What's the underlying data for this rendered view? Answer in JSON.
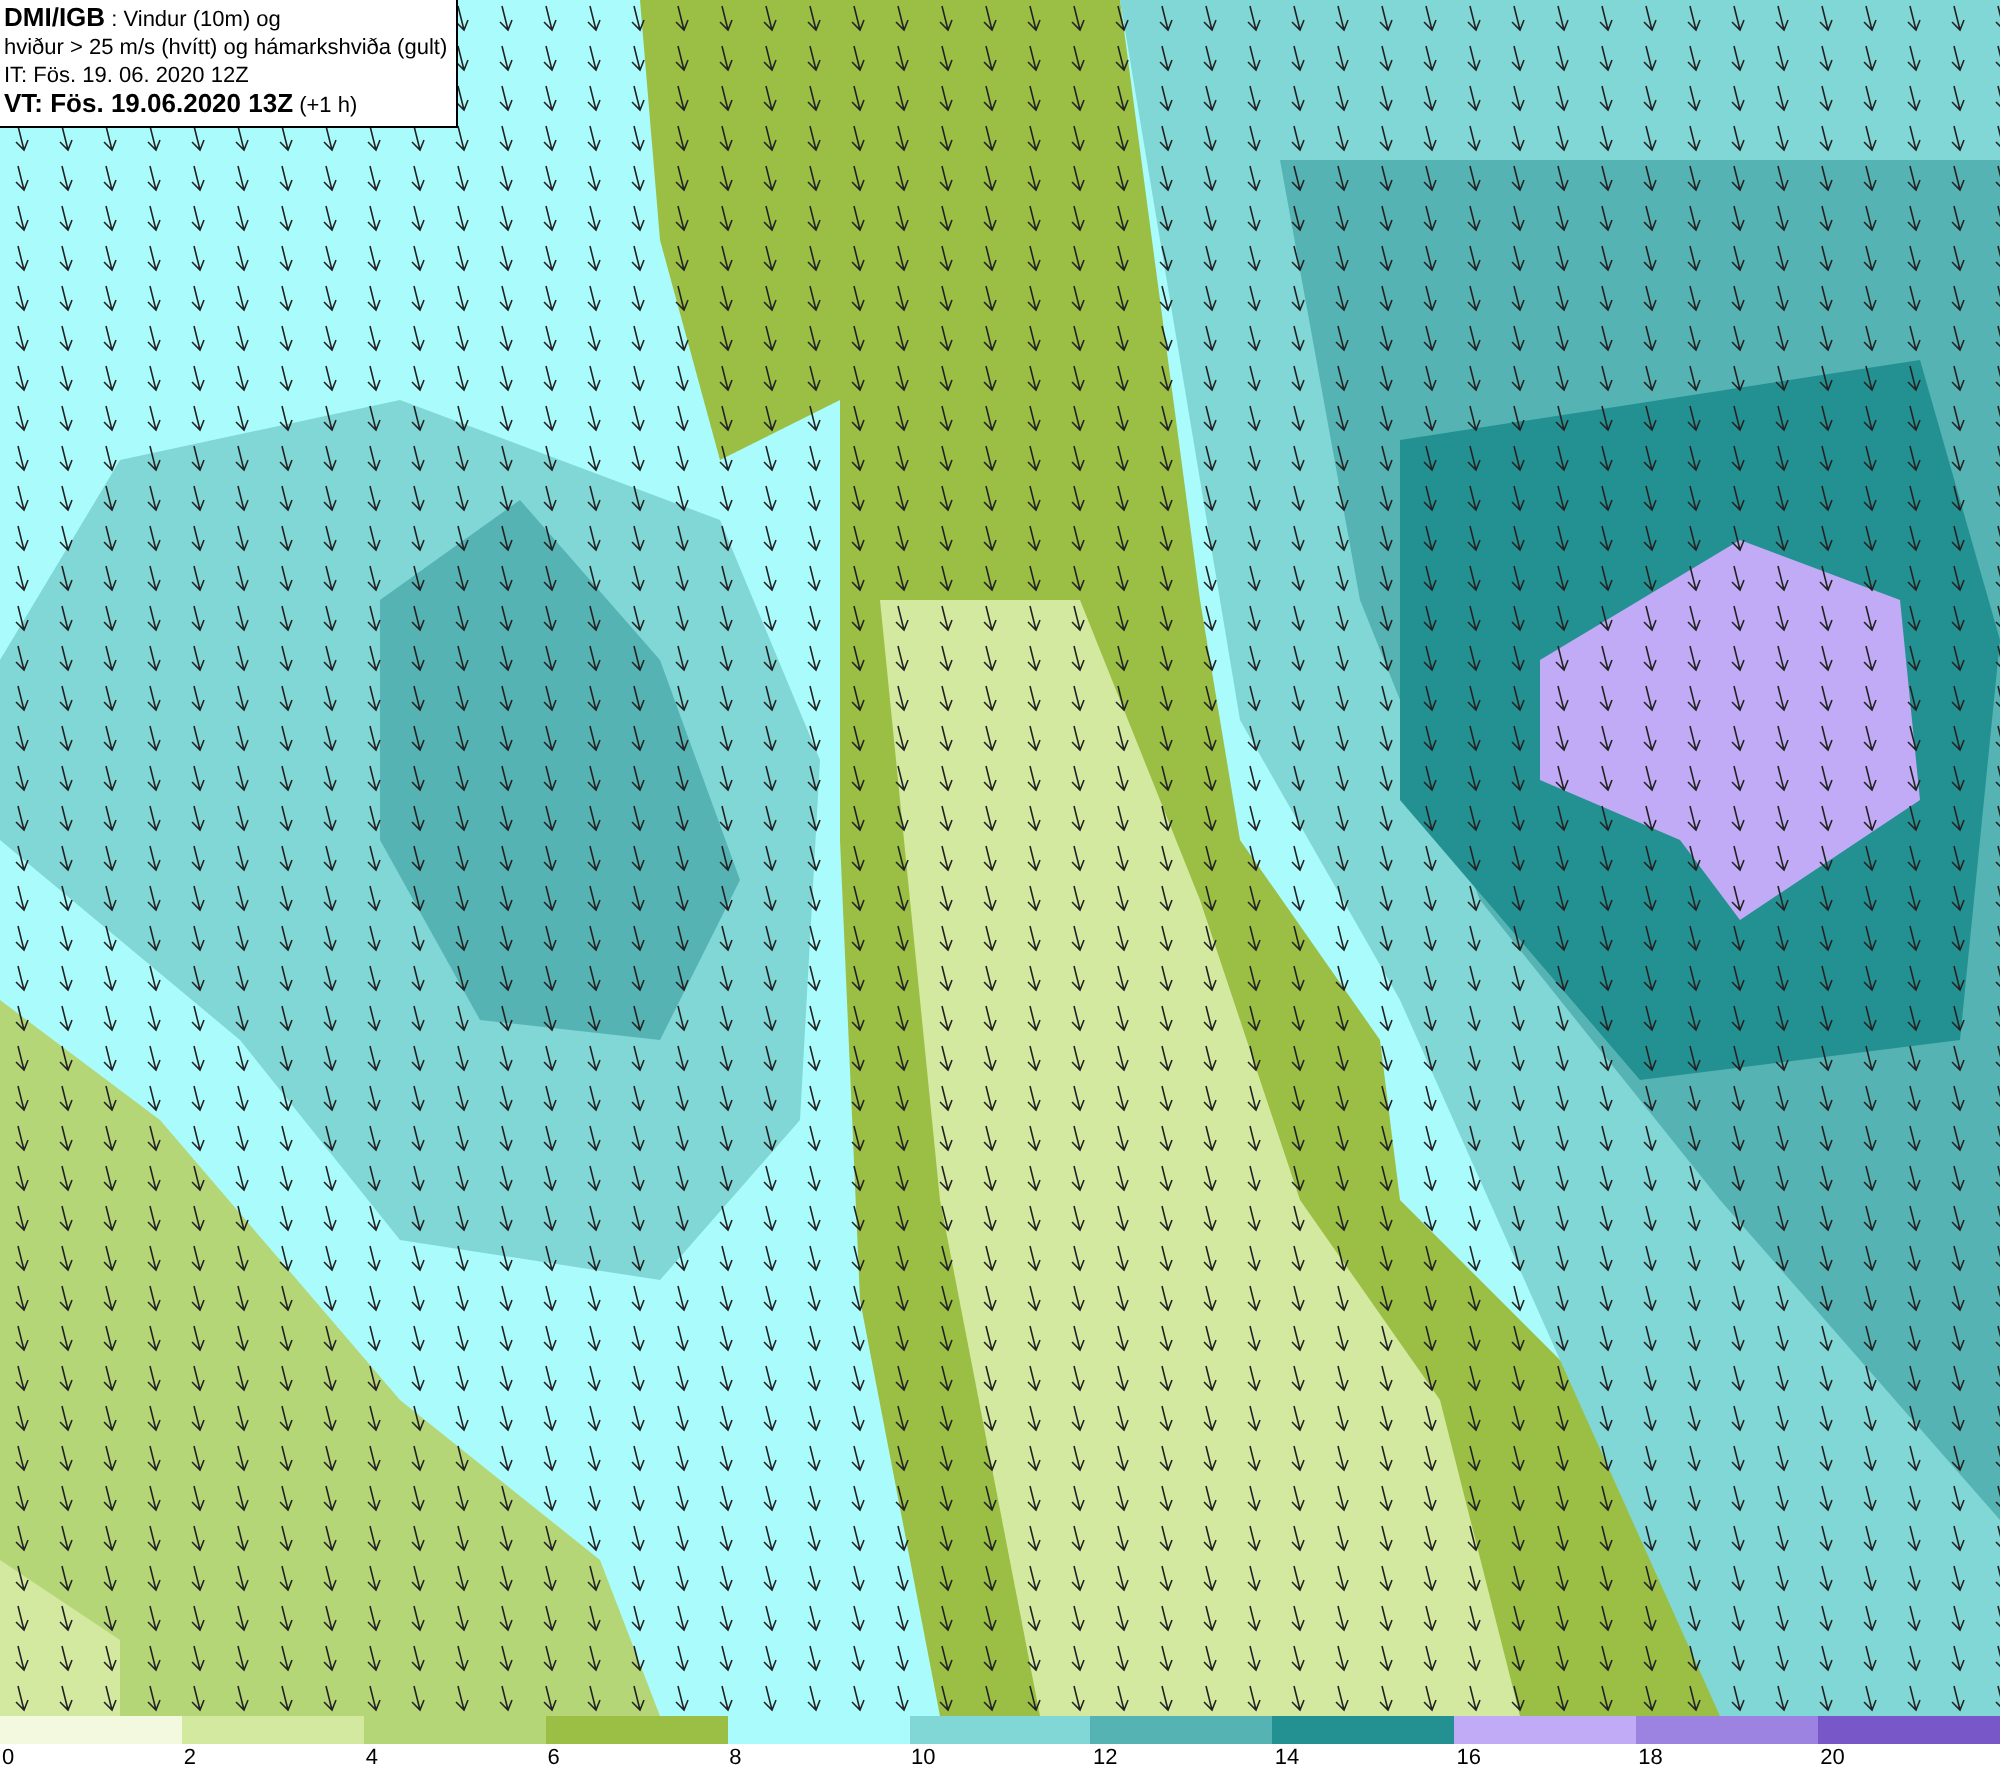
{
  "info_box": {
    "lines": [
      "**DMI/IGB** : Vindur (10m) og",
      "hviður > 25 m/s (hvítt) og hámarkshviða (gult)",
      "IT: Fös. 19. 06. 2020 12Z",
      "**VT: Fös. 19.06.2020 13Z** (+1 h)"
    ]
  },
  "legend": [
    {
      "label": "0",
      "color": "#f2f9df"
    },
    {
      "label": "2",
      "color": "#d4e9a0"
    },
    {
      "label": "4",
      "color": "#b5d677"
    },
    {
      "label": "6",
      "color": "#9bbf45"
    },
    {
      "label": "8",
      "color": "#aafcfc"
    },
    {
      "label": "10",
      "color": "#80d7d6"
    },
    {
      "label": "12",
      "color": "#56b3b3"
    },
    {
      "label": "14",
      "color": "#239191"
    },
    {
      "label": "16",
      "color": "#c2abf6"
    },
    {
      "label": "18",
      "color": "#9c83e1"
    },
    {
      "label": "20",
      "color": "#7857c9"
    }
  ]
}
